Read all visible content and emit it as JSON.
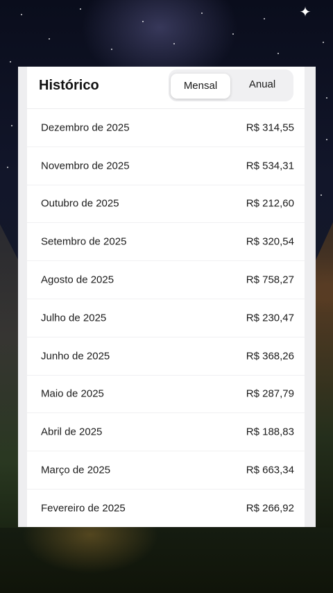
{
  "header": {
    "title": "Histórico",
    "tabs": [
      {
        "label": "Mensal",
        "active": true
      },
      {
        "label": "Anual",
        "active": false
      }
    ]
  },
  "history": [
    {
      "month": "Dezembro de 2025",
      "amount": "R$ 314,55"
    },
    {
      "month": "Novembro de 2025",
      "amount": "R$ 534,31"
    },
    {
      "month": "Outubro de 2025",
      "amount": "R$ 212,60"
    },
    {
      "month": "Setembro de 2025",
      "amount": "R$ 320,54"
    },
    {
      "month": "Agosto de 2025",
      "amount": "R$ 758,27"
    },
    {
      "month": "Julho de 2025",
      "amount": "R$ 230,47"
    },
    {
      "month": "Junho de 2025",
      "amount": "R$ 368,26"
    },
    {
      "month": "Maio de 2025",
      "amount": "R$ 287,79"
    },
    {
      "month": "Abril de 2025",
      "amount": "R$ 188,83"
    },
    {
      "month": "Março de 2025",
      "amount": "R$ 663,34"
    },
    {
      "month": "Fevereiro de 2025",
      "amount": "R$ 266,92"
    }
  ],
  "colors": {
    "card_background": "#ffffff",
    "text": "#1b1b1b",
    "segment_background": "#f0f0f2"
  }
}
